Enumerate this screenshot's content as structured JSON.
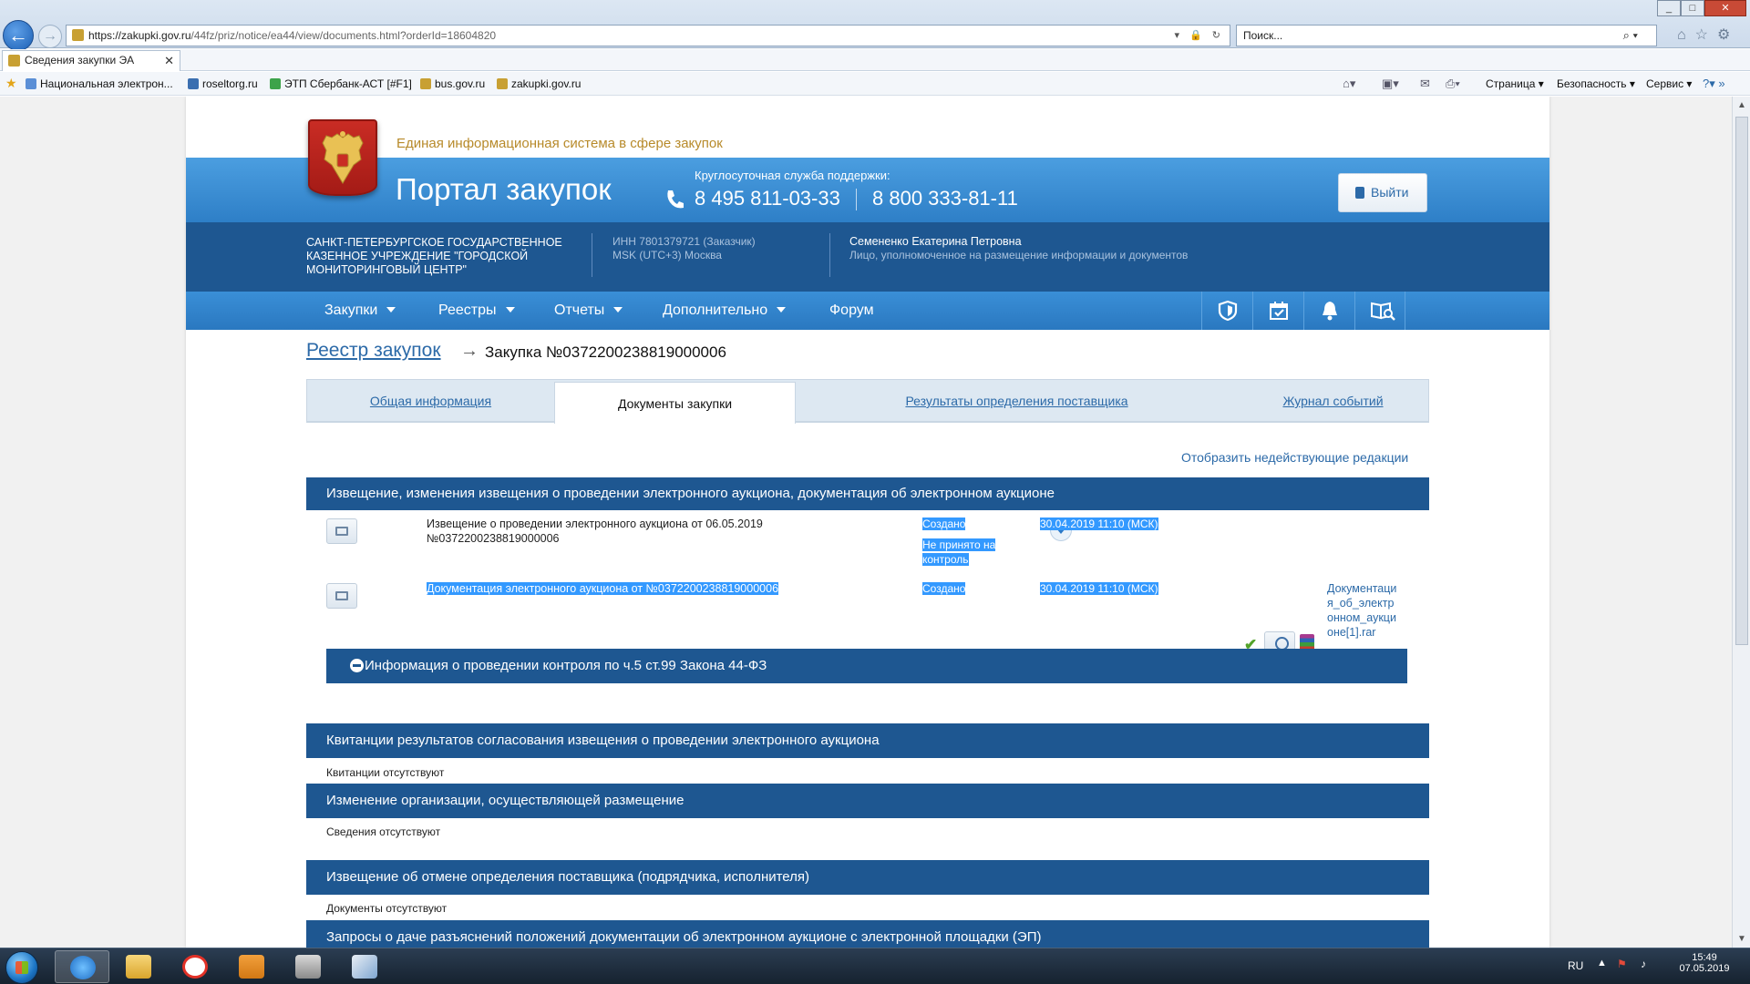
{
  "browser": {
    "address": {
      "host": "https://zakupki.gov.ru",
      "path": "/44fz/priz/notice/ea44/view/documents.html?orderId=18604820"
    },
    "search_placeholder": "Поиск...",
    "tab_title": "Сведения закупки ЭА",
    "favorites": [
      {
        "label": "Национальная электрон...",
        "color": "#5b8fd6"
      },
      {
        "label": "roseltorg.ru",
        "color": "#3b6fb0"
      },
      {
        "label": "ЭТП Сбербанк-АСТ [#F1]",
        "color": "#3da34a"
      },
      {
        "label": "bus.gov.ru",
        "color": "#c8a033"
      },
      {
        "label": "zakupki.gov.ru",
        "color": "#c8a033"
      }
    ],
    "commands": {
      "page": "Страница",
      "security": "Безопасность",
      "service": "Сервис"
    }
  },
  "header": {
    "ets_title": "Единая информационная система в сфере закупок",
    "portal_title": "Портал закупок",
    "support_label": "Круглосуточная служба поддержки:",
    "phone1": "8 495 811-03-33",
    "phone2": "8 800 333-81-11",
    "logout_label": "Выйти"
  },
  "org": {
    "name": "САНКТ-ПЕТЕРБУРГСКОЕ ГОСУДАРСТВЕННОЕ КАЗЕННОЕ УЧРЕЖДЕНИЕ \"ГОРОДСКОЙ МОНИТОРИНГОВЫЙ ЦЕНТР\"",
    "inn": "ИНН 7801379721 (Заказчик)",
    "timezone": "MSK (UTC+3) Москва",
    "user_name": "Семененко Екатерина Петровна",
    "user_role": "Лицо, уполномоченное на размещение информации и документов"
  },
  "nav": {
    "items": [
      "Закупки",
      "Реестры",
      "Отчеты",
      "Дополнительно",
      "Форум"
    ],
    "caret": [
      true,
      true,
      true,
      true,
      false
    ]
  },
  "breadcrumb": {
    "parent": "Реестр закупок",
    "current": "Закупка №0372200238819000006"
  },
  "tabs": [
    "Общая информация",
    "Документы закупки",
    "Результаты определения поставщика",
    "Журнал событий"
  ],
  "active_tab": 1,
  "show_inactive": "Отобразить недействующие редакции",
  "sections": {
    "notice": {
      "title": "Извещение, изменения извещения о проведении электронного аукциона, документация об электронном аукционе",
      "rows": [
        {
          "title": "Извещение о проведении электронного аукциона от 06.05.2019 №0372200238819000006",
          "status1": "Создано",
          "status2": "Не принято на контроль",
          "date": "30.04.2019 11:10 (МСК)"
        },
        {
          "title": "Документация электронного аукциона от №0372200238819000006",
          "status1": "Создано",
          "date": "30.04.2019 11:10 (МСК)",
          "file": "Документация_об_электронном_аукционе[1].rar"
        }
      ],
      "control_bar": "Информация о проведении контроля по ч.5 ст.99 Закона 44-ФЗ"
    },
    "receipts": {
      "title": "Квитанции результатов согласования извещения о проведении электронного аукциона",
      "empty": "Квитанции отсутствуют"
    },
    "org_change": {
      "title": "Изменение организации, осуществляющей размещение",
      "empty": "Сведения отсутствуют"
    },
    "cancel": {
      "title": "Извещение об отмене определения поставщика (подрядчика, исполнителя)",
      "empty": "Документы отсутствуют"
    },
    "requests": {
      "title": "Запросы о даче разъяснений положений документации об электронном аукционе с электронной площадки (ЭП)"
    }
  },
  "taskbar": {
    "lang": "RU",
    "time": "15:49",
    "date": "07.05.2019"
  },
  "colors": {
    "brand_blue": "#1e5791",
    "link": "#2c6aa8",
    "selection": "#3399ff"
  }
}
